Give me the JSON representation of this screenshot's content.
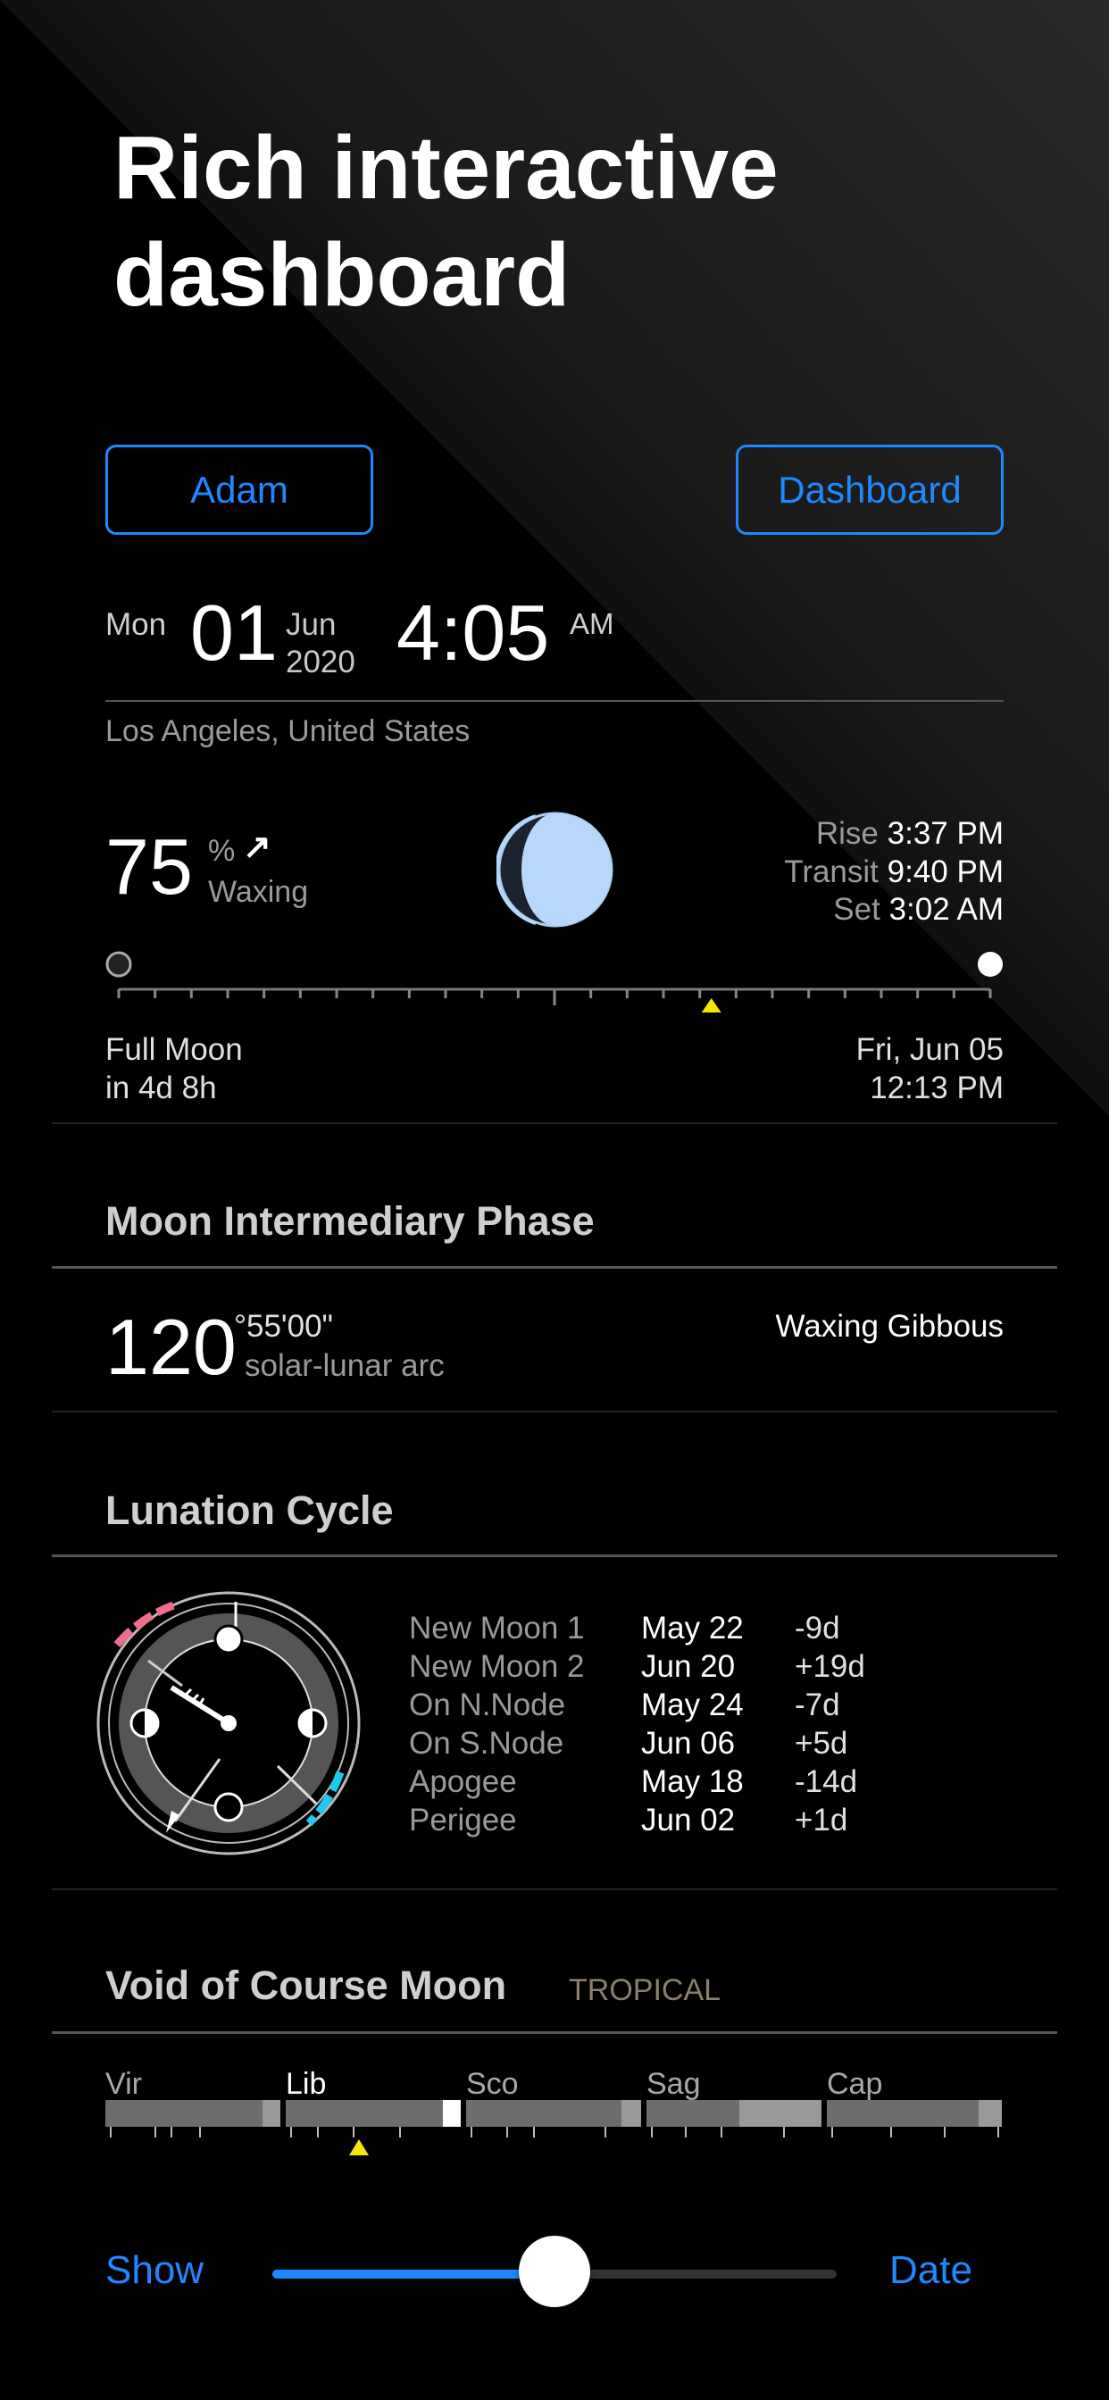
{
  "hero": {
    "title": "Rich interactive dashboard"
  },
  "buttons": {
    "left_label": "Adam",
    "right_label": "Dashboard"
  },
  "datetime": {
    "weekday": "Mon",
    "day": "01",
    "month": "Jun",
    "year": "2020",
    "time": "4:05",
    "ampm": "AM",
    "location": "Los Angeles, United States"
  },
  "moon": {
    "illumination": "75",
    "percent_symbol": "%",
    "trend_arrow": "↗",
    "phase_trend": "Waxing",
    "rise_label": "Rise",
    "rise_value": "3:37 PM",
    "transit_label": "Transit",
    "transit_value": "9:40 PM",
    "set_label": "Set",
    "set_value": "3:02 AM",
    "next_event_label": "Full Moon",
    "next_event_eta": "in 4d 8h",
    "next_event_date": "Fri, Jun 05",
    "next_event_time": "12:13 PM",
    "timeline_position": 0.68
  },
  "intermediary": {
    "title": "Moon Intermediary Phase",
    "degrees": "120",
    "arc_suffix": "°55'00\"",
    "arc_label": "solar-lunar arc",
    "phase_name": "Waxing Gibbous"
  },
  "lunation": {
    "title": "Lunation Cycle",
    "events": [
      {
        "name": "New Moon 1",
        "date": "May 22",
        "delta": "-9d"
      },
      {
        "name": "New Moon 2",
        "date": "Jun 20",
        "delta": "+19d"
      },
      {
        "name": "On N.Node",
        "date": "May 24",
        "delta": "-7d"
      },
      {
        "name": "On S.Node",
        "date": "Jun 06",
        "delta": "+5d"
      },
      {
        "name": "Apogee",
        "date": "May 18",
        "delta": "-14d"
      },
      {
        "name": "Perigee",
        "date": "Jun 02",
        "delta": "+1d"
      }
    ]
  },
  "void_course": {
    "title": "Void of Course Moon",
    "zodiac_mode": "TROPICAL",
    "signs": [
      "Vir",
      "Lib",
      "Sco",
      "Sag",
      "Cap"
    ]
  },
  "bottom": {
    "show_label": "Show",
    "date_label": "Date",
    "slider_value": 0.5
  },
  "colors": {
    "accent": "#1e88ff",
    "marker": "#f5e60a",
    "cyan": "#1ec8f0",
    "pink": "#f06e8c"
  }
}
